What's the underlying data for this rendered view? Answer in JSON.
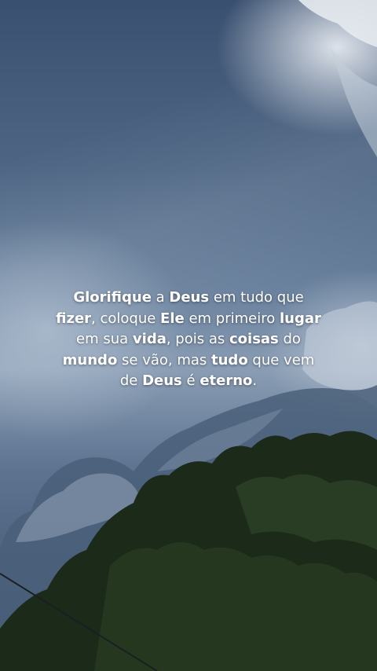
{
  "quote": {
    "segments": [
      {
        "text": "Glorifique",
        "bold": true
      },
      {
        "text": " a ",
        "bold": false
      },
      {
        "text": "Deus",
        "bold": true
      },
      {
        "text": " em tudo que ",
        "bold": false
      },
      {
        "text": "fizer",
        "bold": true
      },
      {
        "text": ", coloque ",
        "bold": false
      },
      {
        "text": "Ele",
        "bold": true
      },
      {
        "text": " em primeiro ",
        "bold": false
      },
      {
        "text": "lugar",
        "bold": true
      },
      {
        "text": " em sua ",
        "bold": false
      },
      {
        "text": "vida",
        "bold": true
      },
      {
        "text": ", pois as ",
        "bold": false
      },
      {
        "text": "coisas",
        "bold": true
      },
      {
        "text": " do ",
        "bold": false
      },
      {
        "text": "mundo",
        "bold": true
      },
      {
        "text": " se vão, mas ",
        "bold": false
      },
      {
        "text": "tudo",
        "bold": true
      },
      {
        "text": " que vem de ",
        "bold": false
      },
      {
        "text": "Deus",
        "bold": true
      },
      {
        "text": " é ",
        "bold": false
      },
      {
        "text": "eterno",
        "bold": true
      },
      {
        "text": ".",
        "bold": false
      }
    ]
  },
  "colors": {
    "sky_top": "#3a5070",
    "text": "#ffffff",
    "foliage": "#1c2a1a"
  }
}
